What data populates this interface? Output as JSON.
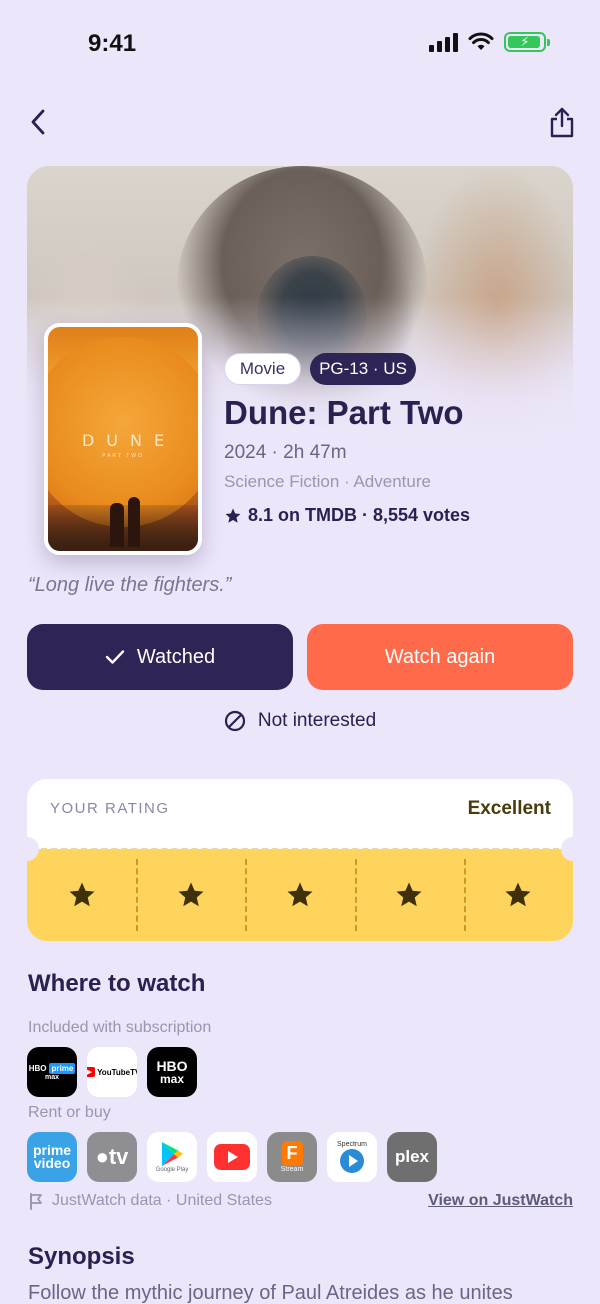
{
  "status_bar": {
    "time": "9:41"
  },
  "nav": {
    "back_icon": "chevron-left-icon",
    "share_icon": "share-icon"
  },
  "movie": {
    "type_chip": "Movie",
    "rating_chip": "PG-13 · US",
    "title": "Dune: Part Two",
    "meta": "2024 · 2h 47m",
    "genres": "Science Fiction · Adventure",
    "score": "8.1 on TMDB · 8,554 votes",
    "tagline": "“Long live the fighters.”",
    "poster_title": "DUNE",
    "poster_subtitle": "PART TWO"
  },
  "actions": {
    "watched_label": "Watched",
    "watch_again_label": "Watch again",
    "not_interested_label": "Not interested"
  },
  "rating": {
    "label": "YOUR RATING",
    "value_text": "Excellent",
    "stars": 5,
    "max": 5
  },
  "where_to_watch": {
    "title": "Where to watch",
    "subscription_label": "Included with subscription",
    "subscription": [
      "HBO Max + Amazon",
      "YouTube TV",
      "HBO Max"
    ],
    "rent_label": "Rent or buy",
    "rent": [
      "prime video",
      "Apple TV",
      "Google Play",
      "YouTube",
      "Fandango",
      "Spectrum",
      "plex"
    ],
    "source_text": "JustWatch data · United States",
    "link_text": "View on JustWatch"
  },
  "synopsis": {
    "title": "Synopsis",
    "text": "Follow the mythic journey of Paul Atreides as he unites"
  },
  "colors": {
    "background": "#ECE6FA",
    "primary": "#2E2456",
    "accent": "#FF6B4A",
    "rating_bg": "#FFD45C"
  }
}
